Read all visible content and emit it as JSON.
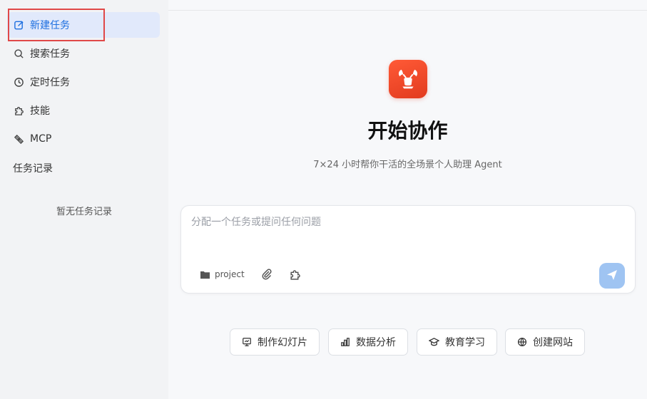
{
  "sidebar": {
    "items": [
      {
        "label": "新建任务",
        "icon": "edit-icon"
      },
      {
        "label": "搜索任务",
        "icon": "search-icon"
      },
      {
        "label": "定时任务",
        "icon": "clock-icon"
      },
      {
        "label": "技能",
        "icon": "puzzle-icon"
      },
      {
        "label": "MCP",
        "icon": "mcp-plug-icon"
      }
    ],
    "history_title": "任务记录",
    "empty_note": "暂无任务记录"
  },
  "main": {
    "logo_icon": "lobster-logo-icon",
    "headline": "开始协作",
    "subline": "7×24 小时帮你干活的全场景个人助理 Agent",
    "composer": {
      "placeholder": "分配一个任务或提问任何问题",
      "project_label": "project"
    },
    "chips": [
      {
        "label": "制作幻灯片",
        "icon": "slides-icon"
      },
      {
        "label": "数据分析",
        "icon": "bar-chart-icon"
      },
      {
        "label": "教育学习",
        "icon": "graduation-cap-icon"
      },
      {
        "label": "创建网站",
        "icon": "globe-icon"
      }
    ]
  },
  "colors": {
    "accent": "#1d6fe0",
    "active_bg": "#e1e9fb",
    "logo": "#e23b1f",
    "send": "#9fc4f2",
    "highlight": "#e04848"
  }
}
